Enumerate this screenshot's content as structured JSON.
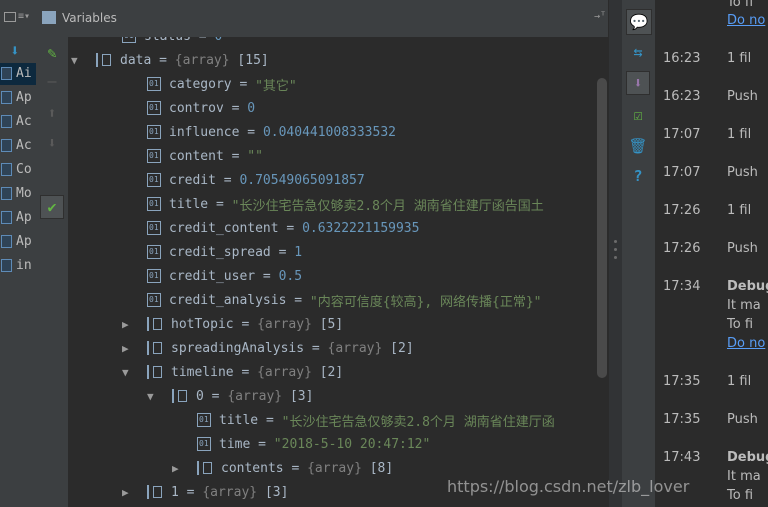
{
  "header": {
    "title": "Variables",
    "pin_glyph": "→ᵀ"
  },
  "frames": [
    {
      "label": "Ai",
      "selected": true
    },
    {
      "label": "Ap",
      "selected": false
    },
    {
      "label": "Ac",
      "selected": false
    },
    {
      "label": "Ac",
      "selected": false
    },
    {
      "label": "Co",
      "selected": false
    },
    {
      "label": "Mo",
      "selected": false
    },
    {
      "label": "Ap",
      "selected": false
    },
    {
      "label": "Ap",
      "selected": false
    },
    {
      "label": "in",
      "selected": false
    }
  ],
  "variables": [
    {
      "name": "status",
      "value": "0",
      "value_kind": "num"
    },
    {
      "name": "data",
      "type": "{array}",
      "count": "[15]",
      "expanded": true
    },
    {
      "name": "category",
      "value": "\"其它\"",
      "value_kind": "str"
    },
    {
      "name": "controv",
      "value": "0",
      "value_kind": "num"
    },
    {
      "name": "influence",
      "value": "0.040441008333532",
      "value_kind": "num"
    },
    {
      "name": "content",
      "value": "\"\"",
      "value_kind": "str"
    },
    {
      "name": "credit",
      "value": "0.70549065091857",
      "value_kind": "num"
    },
    {
      "name": "title",
      "value": "\"长沙住宅告急仅够卖2.8个月 湖南省住建厅函告国土",
      "value_kind": "str"
    },
    {
      "name": "credit_content",
      "value": "0.6322221159935",
      "value_kind": "num"
    },
    {
      "name": "credit_spread",
      "value": "1",
      "value_kind": "num"
    },
    {
      "name": "credit_user",
      "value": "0.5",
      "value_kind": "num"
    },
    {
      "name": "credit_analysis",
      "value": "\"内容可信度{较高}, 网络传播{正常}\"",
      "value_kind": "str"
    },
    {
      "name": "hotTopic",
      "type": "{array}",
      "count": "[5]",
      "expanded": false
    },
    {
      "name": "spreadingAnalysis",
      "type": "{array}",
      "count": "[2]",
      "expanded": false
    },
    {
      "name": "timeline",
      "type": "{array}",
      "count": "[2]",
      "expanded": true
    },
    {
      "name": "0",
      "type": "{array}",
      "count": "[3]",
      "expanded": true
    },
    {
      "name": "title",
      "value": "\"长沙住宅告急仅够卖2.8个月 湖南省住建厅函",
      "value_kind": "str"
    },
    {
      "name": "time",
      "value": "\"2018-5-10 20:47:12\"",
      "value_kind": "str"
    },
    {
      "name": "contents",
      "type": "{array}",
      "count": "[8]",
      "expanded": false
    },
    {
      "name": "1",
      "type": "{array}",
      "count": "[3]",
      "expanded": false
    }
  ],
  "event_log": [
    {
      "time": "",
      "text": "To fi"
    },
    {
      "time": "",
      "link": "Do no"
    },
    {
      "time": "16:23",
      "text": "1 fil"
    },
    {
      "time": "16:23",
      "text": "Push"
    },
    {
      "time": "17:07",
      "text": "1 fil"
    },
    {
      "time": "17:07",
      "text": "Push"
    },
    {
      "time": "17:26",
      "text": "1 fil"
    },
    {
      "time": "17:26",
      "text": "Push"
    },
    {
      "time": "17:34",
      "text": "Debug",
      "bold": true,
      "line2": "It ma",
      "line3": "To fi",
      "link": "Do no"
    },
    {
      "time": "17:35",
      "text": "1 fil"
    },
    {
      "time": "17:35",
      "text": "Push"
    },
    {
      "time": "17:43",
      "text": "Debug",
      "bold": true,
      "line2": "It ma",
      "line3": "To fi"
    }
  ],
  "watermark": "https://blog.csdn.net/zlb_lover"
}
